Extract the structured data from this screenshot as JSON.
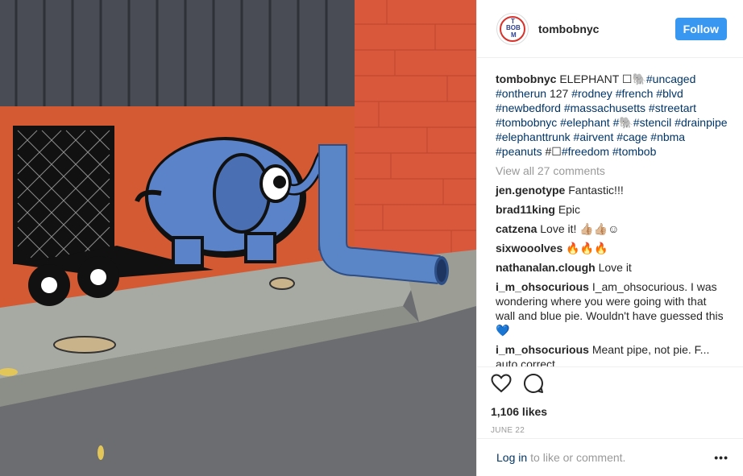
{
  "post": {
    "username": "tombobnyc",
    "follow_label": "Follow",
    "avatar_text": [
      "BOB",
      "T",
      "M"
    ]
  },
  "caption": {
    "username": "tombobnyc",
    "text_before": "ELEPHANT ☐🐘",
    "part2": "127",
    "hashtags_1": [
      "#uncaged",
      "#ontherun"
    ],
    "hashtags_2": [
      "#rodney",
      "#french",
      "#blvd",
      "#newbedford",
      "#massachusetts",
      "#streetart",
      "#tombobnyc",
      "#elephant"
    ],
    "hashtags_3": [
      "#stencil",
      "#drainpipe",
      "#elephanttrunk",
      "#airvent",
      "#cage",
      "#nbma",
      "#peanuts"
    ],
    "hashtags_4": [
      "#freedom",
      "#tombob"
    ],
    "emoji_1": "#🐘",
    "emoji_2": "#☐"
  },
  "view_all": "View all 27 comments",
  "comments": [
    {
      "user": "jen.genotype",
      "text": "Fantastic!!!"
    },
    {
      "user": "brad11king",
      "text": "Epic"
    },
    {
      "user": "catzena",
      "text": "Love it! 👍🏼👍🏼☺"
    },
    {
      "user": "sixwooolves",
      "text": "🔥🔥🔥"
    },
    {
      "user": "nathanalan.clough",
      "text": "Love it"
    },
    {
      "user": "i_m_ohsocurious",
      "text": "I_am_ohsocurious. I was wondering where you were going with that wall and blue pie. Wouldn't have guessed this 💙"
    },
    {
      "user": "i_m_ohsocurious",
      "text": "Meant pipe, not pie. F... auto correct"
    }
  ],
  "likes": "1,106 likes",
  "date": "JUNE 22",
  "footer": {
    "login": "Log in",
    "rest": "to like or comment.",
    "more": "•••"
  },
  "icons": {
    "like": "heart-icon",
    "comment": "comment-icon",
    "options": "more-options-icon"
  },
  "colors": {
    "follow_bg": "#3897f0",
    "hashtag": "#003569",
    "muted": "#999999",
    "brick": "#d9573a",
    "elephant": "#5b83c9"
  }
}
